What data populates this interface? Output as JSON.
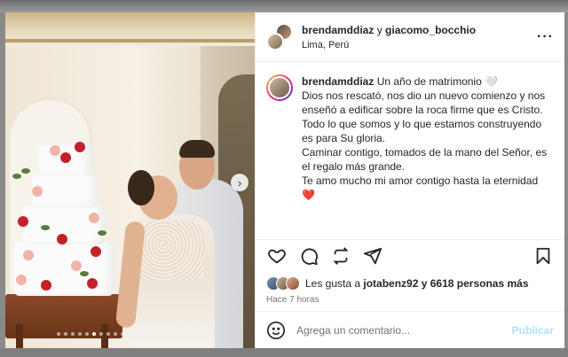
{
  "post": {
    "header": {
      "user1": "brendamddiaz",
      "connector": "y",
      "user2": "giacomo_bocchio",
      "location": "Lima, Perú",
      "more_icon": "more-horizontal-icon"
    },
    "caption": {
      "username": "brendamddiaz",
      "lines": [
        "Un año de matrimonio 🤍",
        "Dios nos rescató, nos dio un nuevo comienzo y nos enseñó a edificar sobre la roca firme que es Cristo.",
        "Todo lo que somos y lo que estamos construyendo es para Su gloria.",
        "Caminar contigo, tomados de la mano del Señor, es el regalo más grande.",
        "Te amo mucho mi amor contigo hasta la eternidad ❤️"
      ]
    },
    "carousel": {
      "total_slides": 10,
      "active_slide": 5
    },
    "actions": {
      "like_icon": "heart-icon",
      "comment_icon": "comment-icon",
      "share_icon": "repost-icon",
      "send_icon": "send-icon",
      "save_icon": "bookmark-icon"
    },
    "likes": {
      "prefix": "Les gusta a",
      "user": "jotabenz92",
      "suffix": "y 6618 personas más"
    },
    "time_ago": "Hace 7 horas",
    "comment_box": {
      "placeholder": "Agrega un comentario...",
      "publish_label": "Publicar",
      "emoji_icon": "emoji-icon"
    }
  }
}
